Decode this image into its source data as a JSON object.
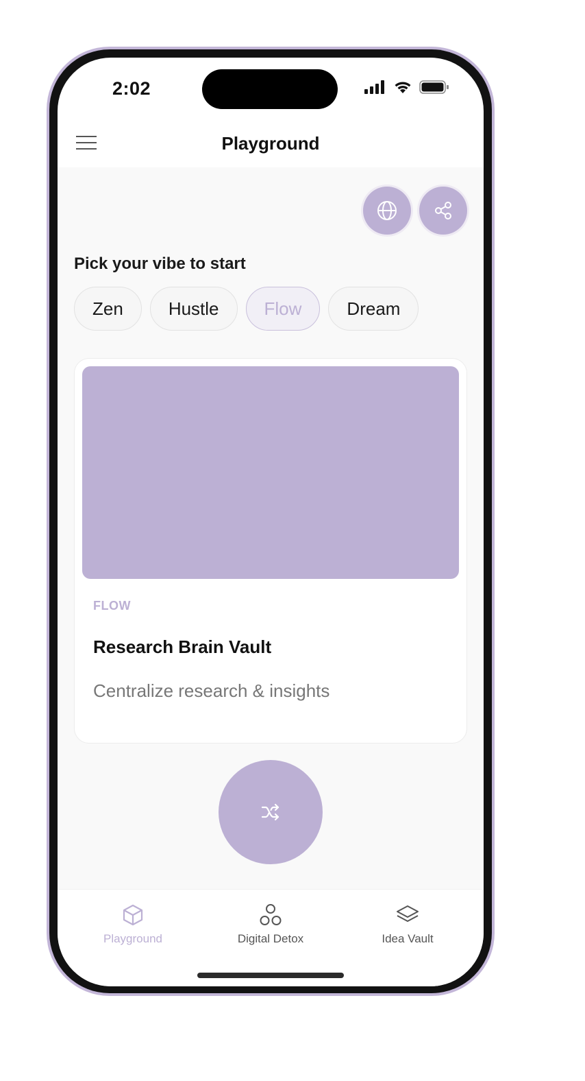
{
  "status_bar": {
    "time": "2:02"
  },
  "header": {
    "title": "Playground"
  },
  "actions": {
    "globe_icon": "globe-icon",
    "share_icon": "share-icon"
  },
  "vibe": {
    "prompt": "Pick your vibe to start",
    "options": [
      {
        "label": "Zen",
        "selected": false
      },
      {
        "label": "Hustle",
        "selected": false
      },
      {
        "label": "Flow",
        "selected": true
      },
      {
        "label": "Dream",
        "selected": false
      }
    ]
  },
  "card": {
    "tag": "FLOW",
    "title": "Research Brain Vault",
    "description": "Centralize research & insights"
  },
  "shuffle": {
    "icon": "shuffle-icon"
  },
  "tabs": [
    {
      "label": "Playground",
      "icon": "cube-icon",
      "active": true
    },
    {
      "label": "Digital Detox",
      "icon": "circles-icon",
      "active": false
    },
    {
      "label": "Idea Vault",
      "icon": "layers-icon",
      "active": false
    }
  ],
  "colors": {
    "accent": "#bcb0d4",
    "frame": "#c3b6d8",
    "text": "#111111",
    "muted": "#777777"
  }
}
